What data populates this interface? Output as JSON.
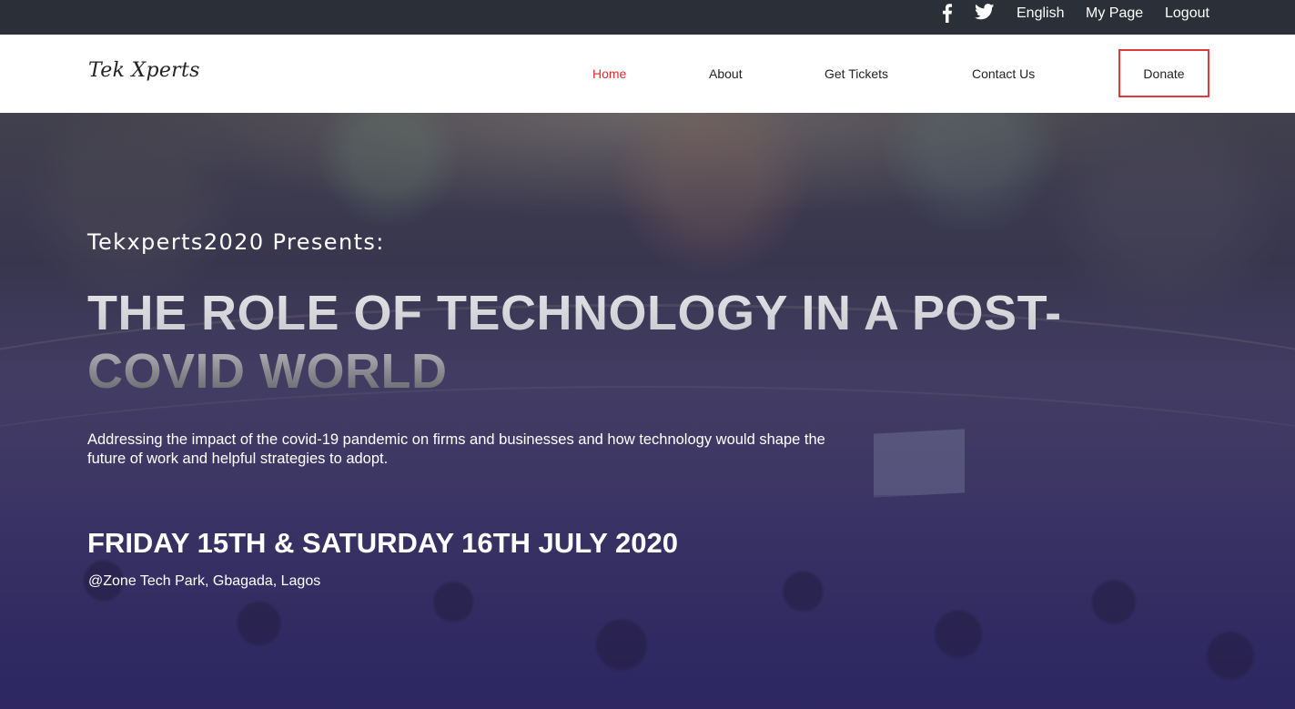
{
  "topbar": {
    "icons": [
      "facebook-icon",
      "twitter-icon"
    ],
    "language": "English",
    "my_page": "My Page",
    "logout": "Logout"
  },
  "navbar": {
    "logo": "Tek Xperts",
    "items": [
      {
        "label": "Home",
        "active": true
      },
      {
        "label": "About"
      },
      {
        "label": "Get Tickets"
      },
      {
        "label": "Contact Us"
      }
    ],
    "donate": "Donate"
  },
  "hero": {
    "presents": "Tekxperts2020 Presents:",
    "headline": "THE ROLE OF TECHNOLOGY IN A POST-COVID WORLD",
    "description": "Addressing the impact of the covid-19 pandemic on firms and businesses and how technology would shape the future of work and helpful strategies to adopt.",
    "dates": "FRIDAY 15TH & SATURDAY 16TH JULY 2020",
    "venue": "@Zone Tech Park, Gbagada, Lagos"
  },
  "colors": {
    "topbar_bg": "#2b2f37",
    "nav_active": "#e8262b",
    "donate_border": "#e33b3b"
  }
}
